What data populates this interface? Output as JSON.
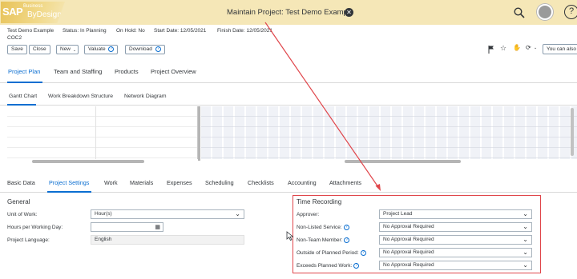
{
  "shell": {
    "logo": {
      "sap": "SAP",
      "business": "Business",
      "bydesign": "ByDesign"
    },
    "title": "Maintain Project: Test Demo Example",
    "close_glyph": "✕",
    "help_glyph": "?"
  },
  "header": {
    "project_name": "Test Demo Example",
    "project_id": "COC2",
    "status": "Status: In Planning",
    "on_hold": "On Hold: No",
    "start_date": "Start Date: 12/05/2021",
    "finish_date": "Finish Date: 12/05/2021"
  },
  "toolbar": {
    "save_label": "Save",
    "close_label": "Close",
    "new_label": "New",
    "valuate_label": "Valuate",
    "download_label": "Download",
    "search_also": "You can also"
  },
  "main_tabs": [
    {
      "label": "Project Plan",
      "active": true
    },
    {
      "label": "Team and Staffing"
    },
    {
      "label": "Products"
    },
    {
      "label": "Project Overview"
    }
  ],
  "sub_tabs": [
    {
      "label": "Gantt Chart",
      "active": true
    },
    {
      "label": "Work Breakdown Structure"
    },
    {
      "label": "Network Diagram"
    }
  ],
  "section_tabs": [
    {
      "label": "Basic Data"
    },
    {
      "label": "Project Settings",
      "active": true
    },
    {
      "label": "Work"
    },
    {
      "label": "Materials"
    },
    {
      "label": "Expenses"
    },
    {
      "label": "Scheduling"
    },
    {
      "label": "Checklists"
    },
    {
      "label": "Accounting"
    },
    {
      "label": "Attachments"
    }
  ],
  "general": {
    "title": "General",
    "unit_of_work_label": "Unit of Work:",
    "unit_of_work_value": "Hour(s)",
    "hours_per_day_label": "Hours per Working Day:",
    "hours_per_day_value": "",
    "project_language_label": "Project Language:",
    "project_language_value": "English"
  },
  "time_recording": {
    "title": "Time Recording",
    "approver_label": "Approver:",
    "approver_value": "Project Lead",
    "non_listed_label": "Non-Listed Service:",
    "non_listed_value": "No Approval Required",
    "non_team_label": "Non-Team Member:",
    "non_team_value": "No Approval Required",
    "outside_label": "Outside of Planned Period:",
    "outside_value": "No Approval Required",
    "exceeds_label": "Exceeds Planned Work:",
    "exceeds_value": "No Approval Required"
  },
  "colors": {
    "shell_bg": "#f5e7b7",
    "accent_blue": "#0a6ed1",
    "annotation_red": "#e0464b"
  }
}
